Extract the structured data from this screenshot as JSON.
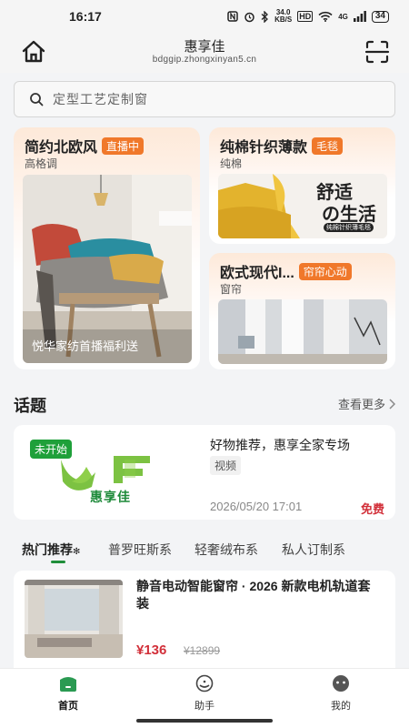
{
  "status": {
    "time": "16:17",
    "net_speed_value": "34.0",
    "net_speed_unit": "KB/S",
    "battery": "34",
    "hd": "HD",
    "signal": "4G"
  },
  "header": {
    "title": "惠享佳",
    "url": "bdggip.zhongxinyan5.cn"
  },
  "search": {
    "placeholder": "定型工艺定制窗"
  },
  "featured": [
    {
      "title": "简约北欧风",
      "badge": "直播中",
      "subtitle": "高格调",
      "caption": "悦华家纺首播福利送"
    },
    {
      "title": "纯棉针织薄款",
      "badge": "毛毯",
      "subtitle": "纯棉",
      "art_text1": "舒适",
      "art_text2": "の生活",
      "art_small": "纯棉针织薄毛毯"
    },
    {
      "title": "欧式现代I...",
      "badge": "帘帘心动",
      "subtitle": "窗帘"
    }
  ],
  "topics": {
    "title": "话题",
    "more": "查看更多",
    "card": {
      "status": "未开始",
      "logo_text": "惠享佳",
      "title": "好物推荐，惠享全家专场",
      "tag": "视频",
      "date": "2026/05/20 17:01",
      "price": "免费"
    }
  },
  "tabs": [
    "热门推荐",
    "普罗旺斯系",
    "轻奢绒布系",
    "私人订制系"
  ],
  "product": {
    "title": "静音电动智能窗帘 · 2026 新款电机轨道套装",
    "price": "¥136",
    "original_price": "¥12899"
  },
  "nav": [
    {
      "label": "首页",
      "icon": "home-icon"
    },
    {
      "label": "助手",
      "icon": "assistant-icon"
    },
    {
      "label": "我的",
      "icon": "profile-icon"
    }
  ],
  "colors": {
    "accent": "#1f8e3a",
    "badge": "#f0782a",
    "price": "#d2303a"
  }
}
